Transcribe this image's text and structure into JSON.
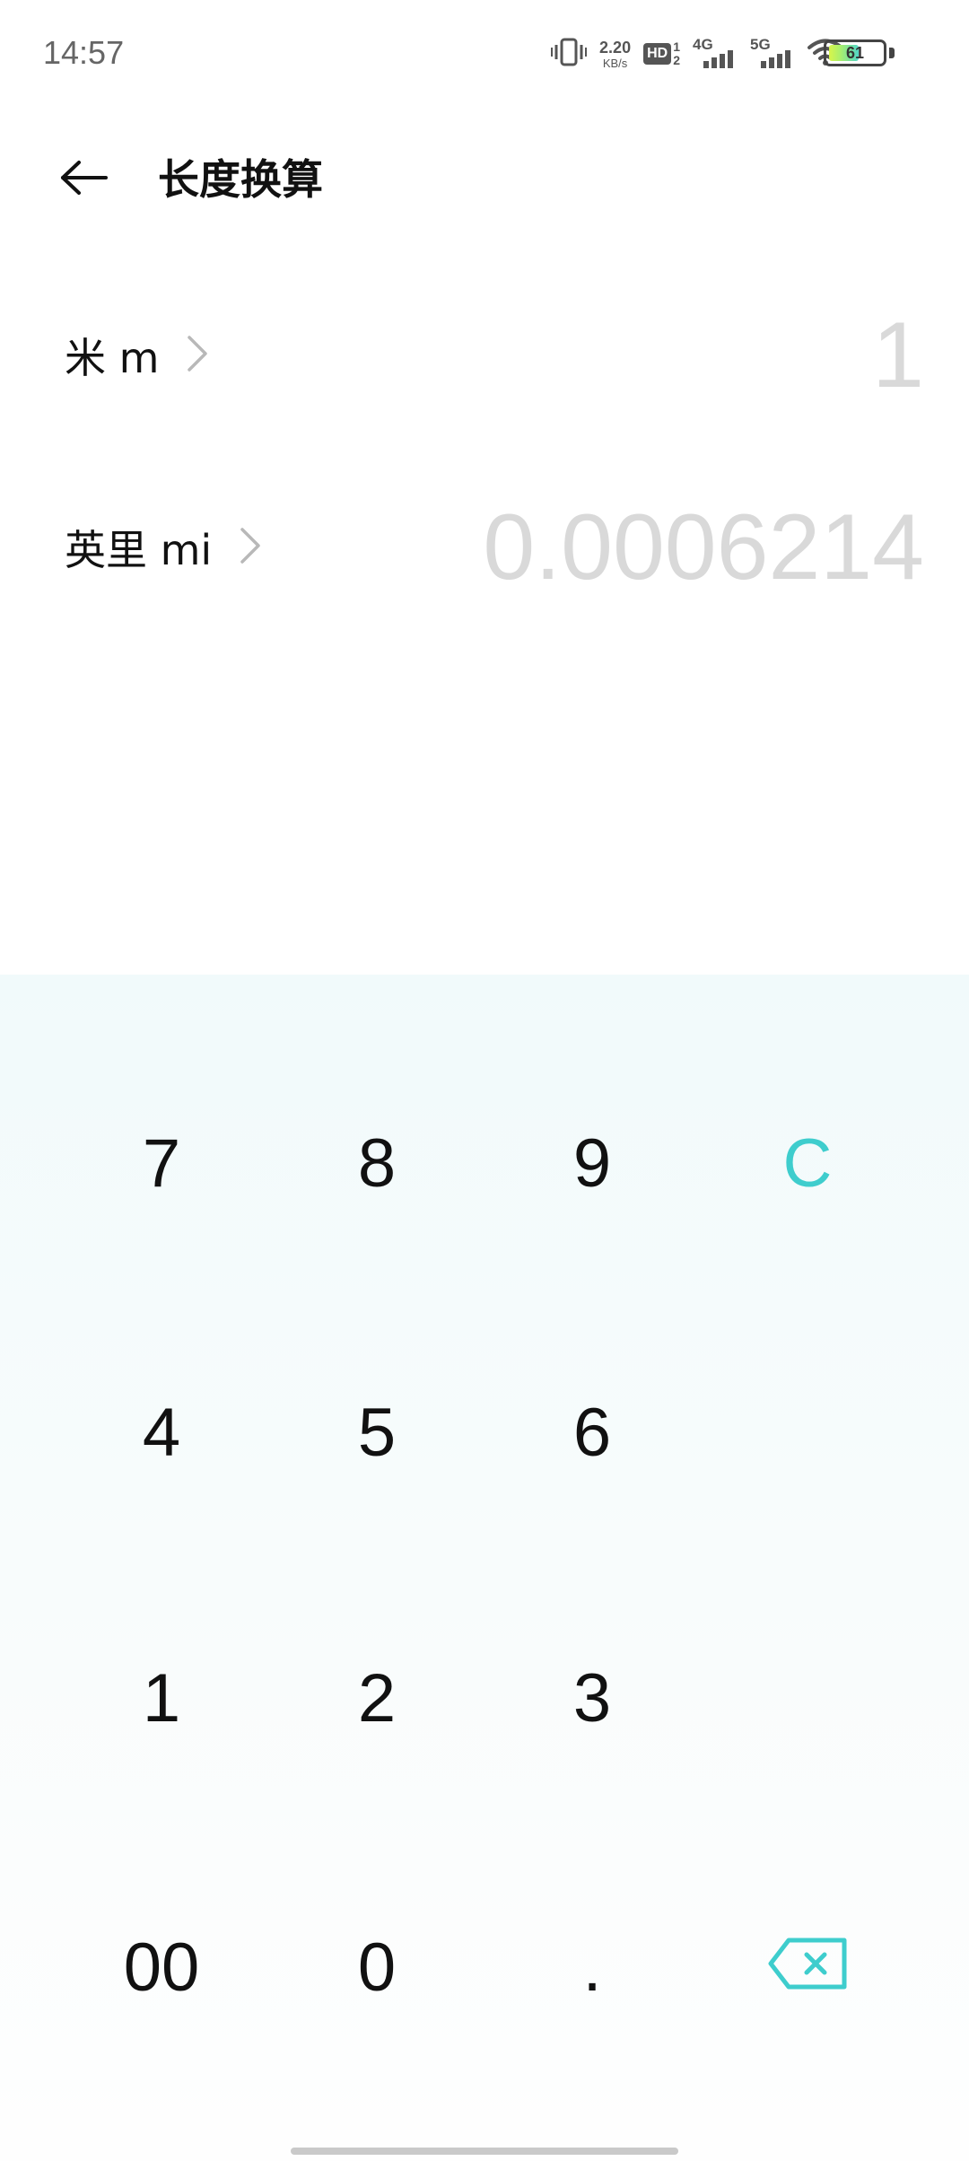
{
  "status_bar": {
    "time": "14:57",
    "net_speed_value": "2.20",
    "net_speed_unit": "KB/s",
    "hd_label": "HD",
    "hd_sim_top": "1",
    "hd_sim_bottom": "2",
    "network_1": "4G",
    "network_2": "5G",
    "battery_level": "61",
    "icons": [
      "vibrate-icon",
      "hd-voice-icon",
      "signal-4g-icon",
      "signal-5g-icon",
      "wifi-icon",
      "battery-icon"
    ]
  },
  "header": {
    "title": "长度换算",
    "back_icon": "arrow-left-icon"
  },
  "conversion": {
    "source": {
      "unit": "米 m",
      "value": "1"
    },
    "target": {
      "unit": "英里 mi",
      "value": "0.0006214"
    },
    "chevron_icon": "chevron-right-icon"
  },
  "keypad": {
    "keys": {
      "k7": "7",
      "k8": "8",
      "k9": "9",
      "clear": "C",
      "k4": "4",
      "k5": "5",
      "k6": "6",
      "k1": "1",
      "k2": "2",
      "k3": "3",
      "k00": "00",
      "k0": "0",
      "dot": "."
    },
    "backspace_icon": "backspace-icon"
  },
  "colors": {
    "accent": "#3ecdcd",
    "value_text": "#d9d9d9",
    "keypad_bg": "#f1fafb"
  }
}
